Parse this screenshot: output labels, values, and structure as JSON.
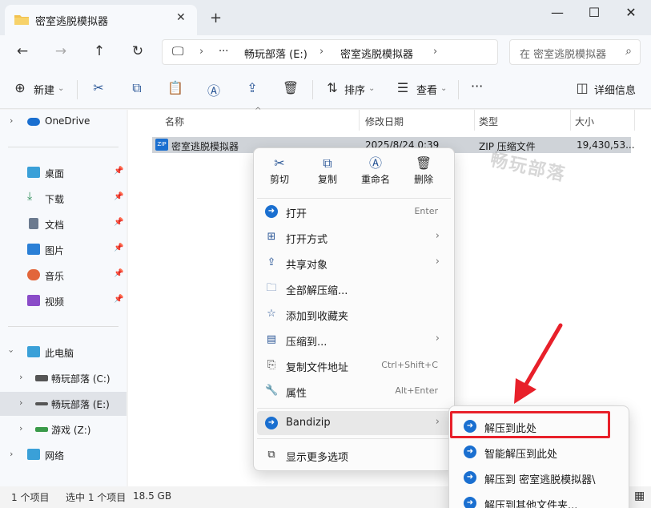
{
  "window": {
    "tab_title": "密室逃脱模拟器",
    "tab_close": "✕",
    "new_tab": "+",
    "minimize": "—",
    "maximize": "☐",
    "close": "✕"
  },
  "nav": {
    "path": [
      "畅玩部落 (E:)",
      "密室逃脱模拟器"
    ],
    "more": "···",
    "search_placeholder": "在 密室逃脱模拟器 中搜索"
  },
  "toolbar": {
    "new_label": "新建",
    "sort_label": "排序",
    "view_label": "查看",
    "more": "···",
    "details_label": "详细信息"
  },
  "sidebar": {
    "items": [
      {
        "label": "OneDrive",
        "icon": "cloud-icon",
        "color": "#1a6fd0"
      },
      {
        "label": "桌面",
        "icon": "desktop-icon",
        "color": "#3aa0d8"
      },
      {
        "label": "下载",
        "icon": "download-icon",
        "color": "#2f8f5b"
      },
      {
        "label": "文档",
        "icon": "document-icon",
        "color": "#6b7a8f"
      },
      {
        "label": "图片",
        "icon": "pictures-icon",
        "color": "#2a7fd6"
      },
      {
        "label": "音乐",
        "icon": "music-icon",
        "color": "#e2663b"
      },
      {
        "label": "视频",
        "icon": "video-icon",
        "color": "#8a4cc8"
      },
      {
        "label": "此电脑",
        "icon": "computer-icon",
        "color": "#3aa0d8"
      },
      {
        "label": "畅玩部落 (C:)",
        "icon": "drive-icon",
        "color": "#555555"
      },
      {
        "label": "畅玩部落 (E:)",
        "icon": "drive-icon",
        "color": "#555555"
      },
      {
        "label": "游戏 (Z:)",
        "icon": "drive-icon",
        "color": "#3a9a4a"
      },
      {
        "label": "网络",
        "icon": "network-icon",
        "color": "#3aa0d8"
      }
    ]
  },
  "list": {
    "columns": [
      "名称",
      "修改日期",
      "类型",
      "大小"
    ],
    "rows": [
      {
        "name": "密室逃脱模拟器",
        "date": "2025/8/24 0:39",
        "type": "ZIP 压缩文件",
        "size": "19,430,53..."
      }
    ],
    "watermark": "畅玩部落"
  },
  "status": {
    "count": "1 个项目",
    "selected": "选中 1 个项目",
    "size": "18.5 GB"
  },
  "context_menu": {
    "quick": [
      {
        "label": "剪切",
        "icon": "scissors-icon"
      },
      {
        "label": "复制",
        "icon": "copy-icon"
      },
      {
        "label": "重命名",
        "icon": "rename-icon"
      },
      {
        "label": "删除",
        "icon": "trash-icon"
      }
    ],
    "items": [
      {
        "label": "打开",
        "shortcut": "Enter"
      },
      {
        "label": "打开方式",
        "shortcut": ""
      },
      {
        "label": "共享对象",
        "shortcut": ""
      },
      {
        "label": "全部解压缩...",
        "shortcut": ""
      },
      {
        "label": "添加到收藏夹",
        "shortcut": ""
      },
      {
        "label": "压缩到...",
        "shortcut": ""
      },
      {
        "label": "复制文件地址",
        "shortcut": "Ctrl+Shift+C"
      },
      {
        "label": "属性",
        "shortcut": "Alt+Enter"
      },
      {
        "label": "Bandizip",
        "shortcut": ""
      },
      {
        "label": "显示更多选项",
        "shortcut": ""
      }
    ]
  },
  "submenu": {
    "items": [
      "解压到此处",
      "智能解压到此处",
      "解压到 密室逃脱模拟器\\",
      "解压到其他文件夹..."
    ]
  },
  "colors": {
    "accent": "#1a6fd0",
    "highlight": "#e8202a"
  }
}
